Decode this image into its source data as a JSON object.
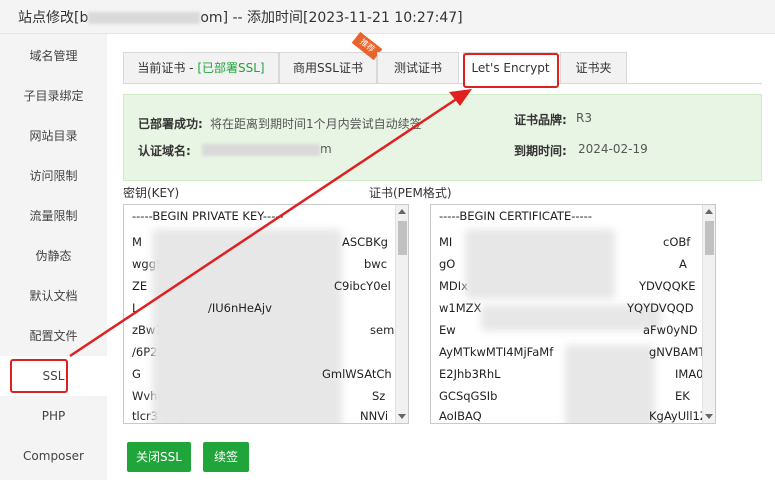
{
  "window": {
    "title_prefix": "站点修改[b",
    "title_suffix": "om] -- 添加时间[2023-11-21 10:27:47]"
  },
  "sidebar": {
    "items": [
      "域名管理",
      "子目录绑定",
      "网站目录",
      "访问限制",
      "流量限制",
      "伪静态",
      "默认文档",
      "配置文件",
      "SSL",
      "PHP",
      "Composer"
    ]
  },
  "tabs": {
    "current_cert": "当前证书 - ",
    "current_cert_status": "[已部署SSL]",
    "commercial": "商用SSL证书",
    "commercial_badge": "推荐",
    "test_cert": "测试证书",
    "lets_encrypt": "Let's Encrypt",
    "cert_folder": "证书夹"
  },
  "info": {
    "deploy_label": "已部署成功:",
    "deploy_text": "将在距离到期时间1个月内尝试自动续签",
    "domain_label": "认证域名:",
    "domain_suffix": "m",
    "brand_label": "证书品牌:",
    "brand_value": "R3",
    "expire_label": "到期时间:",
    "expire_value": "2024-02-19"
  },
  "key_box": {
    "label": "密钥(KEY)",
    "lines": [
      "-----BEGIN PRIVATE KEY-----",
      "M",
      "wggSkA",
      "ZE",
      "L",
      "zBw7SD",
      "/6P2zw",
      "G",
      "WvhCJiv",
      "tlcr3Tpdg"
    ],
    "right_fragments": [
      "",
      "ASCBKg",
      "bwc",
      "C9ibcY0el",
      "/IU6nHeAjv",
      "sem",
      "",
      "GmlWSAtCh",
      "Sz",
      "NNVi"
    ]
  },
  "cert_box": {
    "label": "证书(PEM格式)",
    "lines": [
      "-----BEGIN CERTIFICATE-----",
      "MI",
      "gO",
      "MDIx",
      "w1MZX",
      "Ew",
      "AyMTkwMTI4MjFaMf",
      "E2Jhb3RhL",
      "GCSqGSIb",
      "AoIBAQ"
    ],
    "right_fragments": [
      "",
      "cOBf",
      "A",
      "YDVQQKE",
      "YQYDVQQD",
      "aFw0yND",
      "gNVBAMT",
      "IMA0",
      "EK",
      "KgAyUll1Z"
    ]
  },
  "buttons": {
    "close_ssl": "关闭SSL",
    "renew": "续签"
  }
}
